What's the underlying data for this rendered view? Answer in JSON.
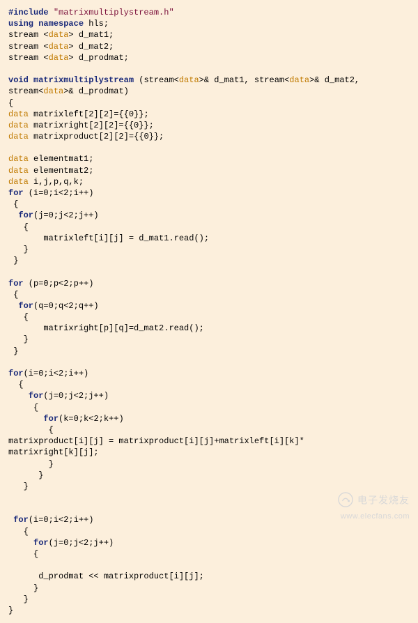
{
  "code": {
    "include_kw": "#include",
    "include_str": "\"matrixmultiplystream.h\"",
    "using_kw1": "using",
    "using_kw2": "namespace",
    "using_ns": " hls;",
    "stream_decl_prefix": "stream <",
    "data_type": "data",
    "stream_decl_suffix1": "> d_mat1;",
    "stream_decl_suffix2": "> d_mat2;",
    "stream_decl_suffix3": "> d_prodmat;",
    "void_kw": "void",
    "fn_name": "matrixmultiplystream",
    "sig_p1": " (stream<",
    "sig_p2": ">& d_mat1, stream<",
    "sig_p3": ">& d_mat2,",
    "sig_line2_a": "stream<",
    "sig_line2_b": ">& d_prodmat)",
    "lbrace": "{",
    "rbrace": "}",
    "decl_ml": " matrixleft[2][2]={{0}};",
    "decl_mr": " matrixright[2][2]={{0}};",
    "decl_mp": " matrixproduct[2][2]={{0}};",
    "decl_em1": " elementmat1;",
    "decl_em2": " elementmat2;",
    "decl_vars": " i,j,p,q,k;",
    "for_kw": "for",
    "for_i": " (i=0;i<2;i++)",
    "for_j_a": "(j=0;j<2;j++)",
    "read1": "       matrixleft[i][j] = d_mat1.read();",
    "for_p": " (p=0;p<2;p++)",
    "for_q_a": "(q=0;q<2;q++)",
    "read2": "       matrixright[p][q]=d_mat2.read();",
    "for_k_a": "(k=0;k<2;k++)",
    "mult_line1": "matrixproduct[i][j] = matrixproduct[i][j]+matrixleft[i][k]*",
    "mult_line2": "matrixright[k][j];",
    "out_line": "      d_prodmat << matrixproduct[i][j];",
    "for_i2": "(i=0;i<2;i++)"
  },
  "watermark": {
    "brand": "电子发烧友",
    "url": "www.elecfans.com"
  }
}
